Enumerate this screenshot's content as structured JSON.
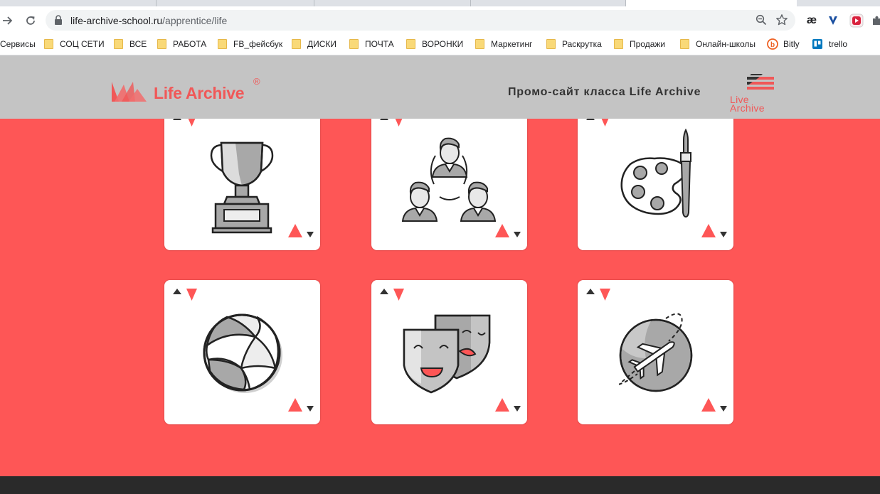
{
  "browser": {
    "url_host": "life-archive-school.ru",
    "url_path": "/apprentice/life"
  },
  "bookmarks": [
    {
      "label": "Сервисы",
      "type": "apps"
    },
    {
      "label": "СОЦ СЕТИ",
      "type": "folder"
    },
    {
      "label": "ВСЕ",
      "type": "folder"
    },
    {
      "label": "РАБОТА",
      "type": "folder"
    },
    {
      "label": "FB_фейсбук",
      "type": "folder"
    },
    {
      "label": "ДИСКИ",
      "type": "folder"
    },
    {
      "label": "ПОЧТА",
      "type": "folder"
    },
    {
      "label": "ВОРОНКИ",
      "type": "folder"
    },
    {
      "label": "Маркетинг",
      "type": "folder"
    },
    {
      "label": "Раскрутка",
      "type": "folder"
    },
    {
      "label": "Продажи",
      "type": "folder"
    },
    {
      "label": "Онлайн-школы",
      "type": "folder"
    },
    {
      "label": "Bitly",
      "type": "bitly"
    },
    {
      "label": "trello",
      "type": "trello"
    }
  ],
  "header": {
    "logo_text": "Life Archive",
    "logo_reg": "®",
    "promo_text": "Промо-сайт класса Life Archive",
    "live_line1": "Live",
    "live_line2": "Archive"
  },
  "cards": [
    {
      "icon": "trophy-icon"
    },
    {
      "icon": "team-network-icon"
    },
    {
      "icon": "paint-palette-icon"
    },
    {
      "icon": "volleyball-icon"
    },
    {
      "icon": "theater-masks-icon"
    },
    {
      "icon": "globe-airplane-icon"
    }
  ],
  "colors": {
    "accent": "#fe5656",
    "header_bg": "#c4c4c4",
    "footer_bg": "#2a2a2a",
    "logo": "#f05858"
  }
}
